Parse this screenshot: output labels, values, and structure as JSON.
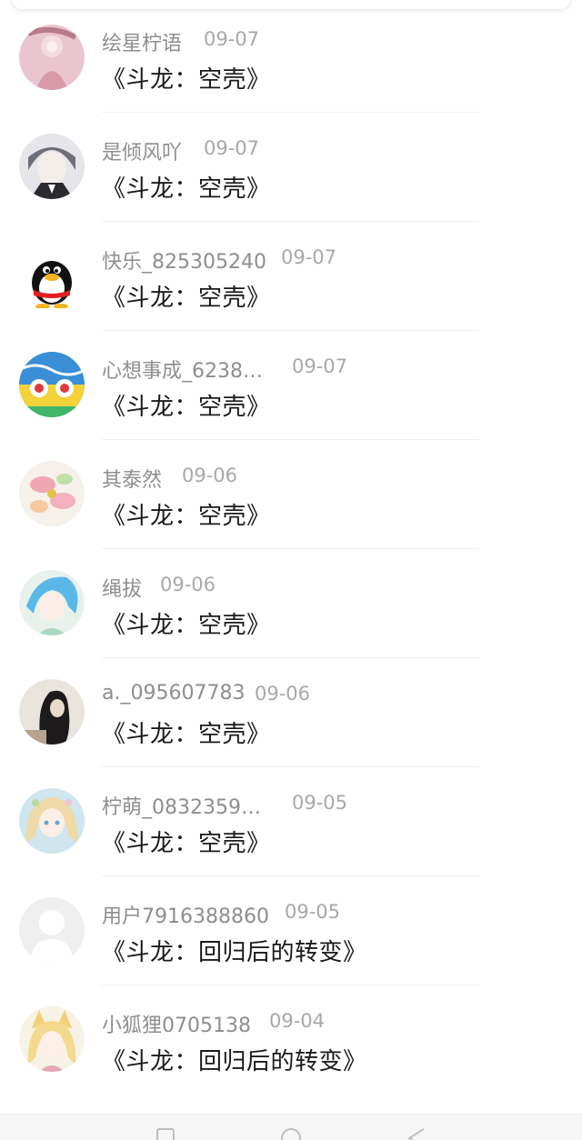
{
  "items": [
    {
      "user": "绘星柠语",
      "date": "09-07",
      "title": "《斗龙：空壳》",
      "avatar": "pink-girl-avatar"
    },
    {
      "user": "是倾风吖",
      "date": "09-07",
      "title": "《斗龙：空壳》",
      "avatar": "anime-boy-avatar"
    },
    {
      "user": "快乐_825305240",
      "date": "09-07",
      "title": "《斗龙：空壳》",
      "avatar": "penguin-avatar"
    },
    {
      "user": "心想事成_6238…",
      "date": "09-07",
      "title": "《斗龙：空壳》",
      "avatar": "colorful-painting-avatar"
    },
    {
      "user": "其泰然",
      "date": "09-06",
      "title": "《斗龙：空壳》",
      "avatar": "flower-avatar"
    },
    {
      "user": "绳拔",
      "date": "09-06",
      "title": "《斗龙：空壳》",
      "avatar": "blue-hair-girl-avatar"
    },
    {
      "user": "a._095607783",
      "date": "09-06",
      "title": "《斗龙：空壳》",
      "avatar": "dark-photo-avatar"
    },
    {
      "user": "柠萌_0832359…",
      "date": "09-05",
      "title": "《斗龙：空壳》",
      "avatar": "blonde-girl-avatar"
    },
    {
      "user": "用户7916388860",
      "date": "09-05",
      "title": "《斗龙：回归后的转变》",
      "avatar": "default-user-avatar"
    },
    {
      "user": "小狐狸0705138",
      "date": "09-04",
      "title": "《斗龙：回归后的转变》",
      "avatar": "fox-girl-avatar"
    }
  ],
  "colors": {
    "username": "#8e8e8e",
    "date": "#a8a8a8",
    "title": "#1a1a1a",
    "divider": "#f0f0f0",
    "background": "#ffffff"
  },
  "bottom_nav": {
    "icons": [
      "square-icon",
      "circle-icon",
      "back-triangle-icon"
    ]
  }
}
